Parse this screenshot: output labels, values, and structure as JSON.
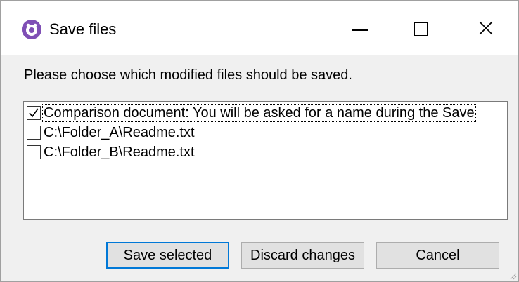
{
  "window": {
    "title": "Save files",
    "icon": "app-icon",
    "controls": {
      "minimize": "minimize-icon",
      "maximize": "maximize-icon",
      "close": "close-icon"
    }
  },
  "dialog": {
    "prompt": "Please choose which modified files should be saved.",
    "files": [
      {
        "label": "Comparison document: You will be asked for a name during the Save",
        "checked": true
      },
      {
        "label": "C:\\Folder_A\\Readme.txt",
        "checked": false
      },
      {
        "label": "C:\\Folder_B\\Readme.txt",
        "checked": false
      }
    ],
    "buttons": {
      "save_selected": "Save selected",
      "discard_changes": "Discard changes",
      "cancel": "Cancel"
    }
  },
  "colors": {
    "accent": "#0078d7",
    "app_icon": "#7f4fb5",
    "dialog_bg": "#f0f0f0"
  }
}
